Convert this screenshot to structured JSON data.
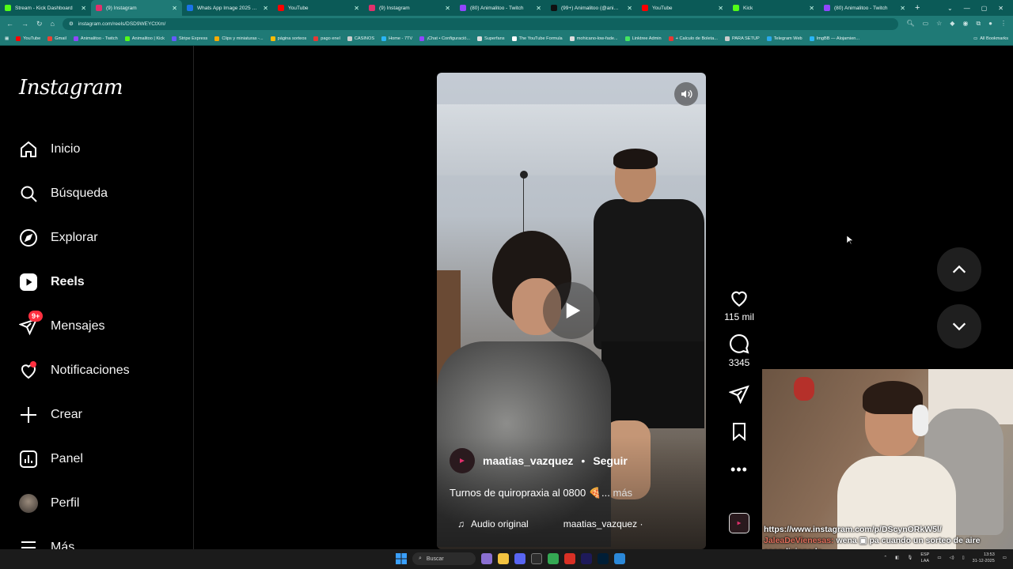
{
  "browser": {
    "tabs": [
      {
        "title": "Stream - Kick Dashboard",
        "color": "#53fc18"
      },
      {
        "title": "(9) Instagram",
        "color": "#e1306c",
        "active": true
      },
      {
        "title": "Whats App Image 2025 12 31 ...",
        "color": "#1a73e8"
      },
      {
        "title": "YouTube",
        "color": "#ff0000"
      },
      {
        "title": "(9) Instagram",
        "color": "#e1306c"
      },
      {
        "title": "(80) Animalitoo - Twitch",
        "color": "#9146ff"
      },
      {
        "title": "(99+) Animalitoo (@animalito...",
        "color": "#111111"
      },
      {
        "title": "YouTube",
        "color": "#ff0000"
      },
      {
        "title": "Kick",
        "color": "#53fc18"
      },
      {
        "title": "(80) Animalitoo - Twitch",
        "color": "#9146ff"
      }
    ],
    "url": "instagram.com/reels/DSD9WEYCtXm/",
    "bookmarks": [
      {
        "label": "YouTube",
        "color": "#ff0000"
      },
      {
        "label": "Gmail",
        "color": "#ea4335"
      },
      {
        "label": "Animalitoo - Twitch",
        "color": "#9146ff"
      },
      {
        "label": "Animalitoo | Kick",
        "color": "#53fc18"
      },
      {
        "label": "Stripe Express",
        "color": "#635bff"
      },
      {
        "label": "Clips y miniaturas -...",
        "color": "#f9ab00"
      },
      {
        "label": "página sorteos",
        "color": "#fbbc04"
      },
      {
        "label": "pago enel",
        "color": "#e53935"
      },
      {
        "label": "CASINOS",
        "color": "#cccccc"
      },
      {
        "label": "Home - 7TV",
        "color": "#29b6f6"
      },
      {
        "label": "¡Chat • Configuració...",
        "color": "#9146ff"
      },
      {
        "label": "Superfans",
        "color": "#dddddd"
      },
      {
        "label": "The YouTube Formula",
        "color": "#ffffff"
      },
      {
        "label": "mohicano-low-fade...",
        "color": "#dddddd"
      },
      {
        "label": "Linktree Admin",
        "color": "#43e660"
      },
      {
        "label": "+ Calculo de Boleta...",
        "color": "#e53935"
      },
      {
        "label": "PARA SETUP",
        "color": "#cccccc"
      },
      {
        "label": "Telegram Web",
        "color": "#29a9eb"
      },
      {
        "label": "ImgBB — Alojamien...",
        "color": "#29b6f6"
      }
    ],
    "all_bookmarks": "All Bookmarks"
  },
  "instagram": {
    "logo": "Instagram",
    "nav": {
      "inicio": "Inicio",
      "busqueda": "Búsqueda",
      "explorar": "Explorar",
      "reels": "Reels",
      "mensajes": "Mensajes",
      "mensajes_badge": "9+",
      "notificaciones": "Notificaciones",
      "crear": "Crear",
      "panel": "Panel",
      "perfil": "Perfil",
      "mas": "Más"
    },
    "reel": {
      "username": "maatias_vazquez",
      "separator": "•",
      "follow": "Seguir",
      "caption": "Turnos de quiropraxia al 0800 🍕...",
      "more": "más",
      "audio_label": "Audio original",
      "audio_user": "maatias_vazquez ·"
    },
    "actions": {
      "likes": "115 mil",
      "comments": "3345"
    }
  },
  "stream_overlay": {
    "link": "https://www.instagram.com/p/DScynORkW5l/",
    "chat_user": "JaleaDeVienesas:",
    "chat_message": "wena ▣ pa cuando un sorteo de aire acondicionado"
  },
  "taskbar": {
    "search_placeholder": "Buscar",
    "lang_top": "ESP",
    "lang_bottom": "LAA",
    "time": "13:53",
    "date": "31-12-2025"
  }
}
